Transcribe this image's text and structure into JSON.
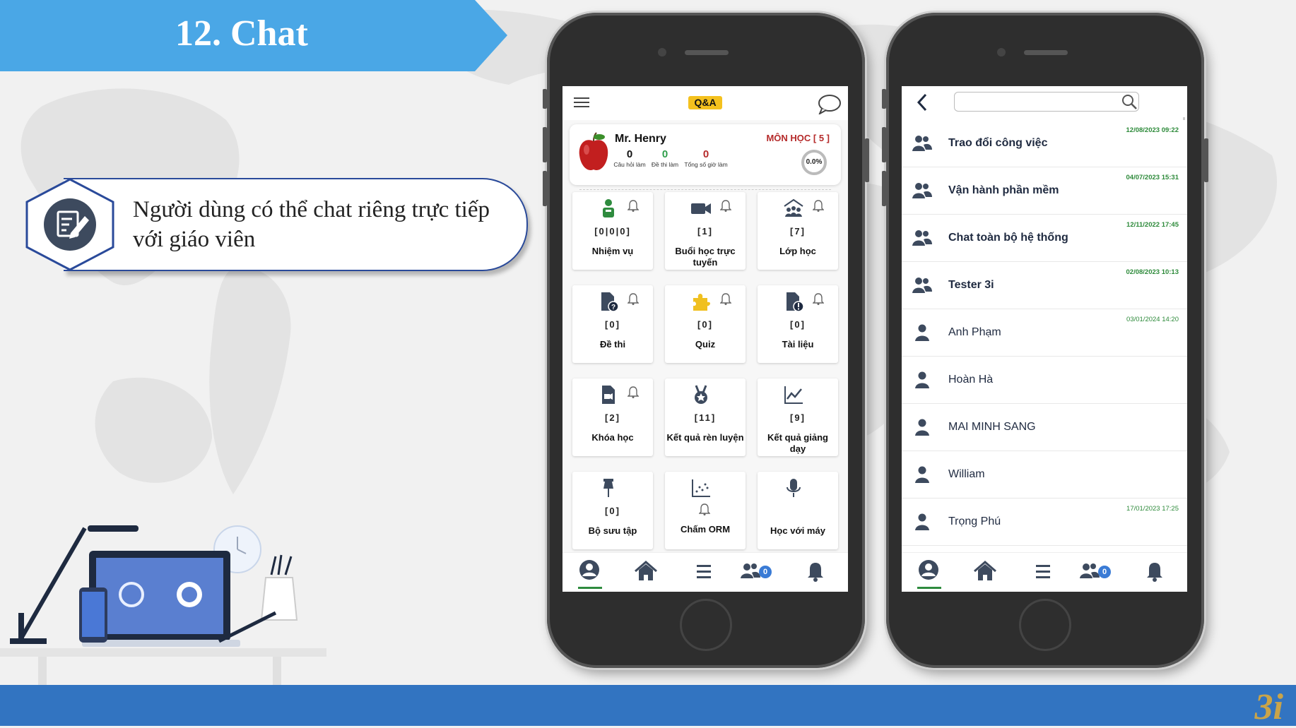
{
  "slide": {
    "title": "12. Chat",
    "callout_text": "Người dùng có thể chat riêng trực tiếp với giáo viên",
    "logo_text": "3i",
    "colors": {
      "banner": "#4aa7e6",
      "bottom_bar": "#3274c1",
      "callout_border": "#2a4a9a"
    }
  },
  "left_phone": {
    "header": {
      "logo": "Q&A",
      "icons": [
        "menu-icon",
        "chat-bubble-icon"
      ]
    },
    "profile": {
      "name": "Mr. Henry",
      "subject_label": "MÔN HỌC [ 5 ]",
      "progress": "0.0%",
      "stats": [
        {
          "value": "0",
          "label": "Câu hỏi làm",
          "color": "#111111"
        },
        {
          "value": "0",
          "label": "Đề thi làm",
          "color": "#2e9e4a"
        },
        {
          "value": "0",
          "label": "Tổng số giờ làm",
          "color": "#b52a2a"
        }
      ]
    },
    "tiles": [
      {
        "label": "Nhiệm vụ",
        "count": "[0|0|0]",
        "icon": "task-person-icon"
      },
      {
        "label": "Buổi học trực tuyến",
        "count": "[1]",
        "icon": "video-icon"
      },
      {
        "label": "Lớp học",
        "count": "[7]",
        "icon": "classroom-icon"
      },
      {
        "label": "Đề thi",
        "count": "[0]",
        "icon": "exam-doc-icon"
      },
      {
        "label": "Quiz",
        "count": "[0]",
        "icon": "puzzle-icon"
      },
      {
        "label": "Tài liệu",
        "count": "[0]",
        "icon": "document-alert-icon"
      },
      {
        "label": "Khóa học",
        "count": "[2]",
        "icon": "course-icon"
      },
      {
        "label": "Kết quả rèn luyện",
        "count": "[11]",
        "icon": "medal-icon"
      },
      {
        "label": "Kết quả giảng dạy",
        "count": "[9]",
        "icon": "chart-line-icon"
      },
      {
        "label": "Bộ sưu tập",
        "count": "[0]",
        "icon": "pin-icon"
      },
      {
        "label": "Chấm ORM",
        "count": "",
        "icon": "scatter-icon"
      },
      {
        "label": "Học với máy",
        "count": "",
        "icon": "microphone-icon"
      }
    ],
    "bottom_nav": {
      "badge_count": "0",
      "items": [
        "profile-icon",
        "home-icon",
        "menu-icon",
        "group-icon",
        "bell-icon"
      ]
    }
  },
  "right_phone": {
    "search_placeholder": "",
    "chats": [
      {
        "name": "Trao đổi công việc",
        "time": "12/08/2023 09:22",
        "group": true
      },
      {
        "name": "Vận hành phần mềm",
        "time": "04/07/2023 15:31",
        "group": true
      },
      {
        "name": "Chat toàn bộ hệ thống",
        "time": "12/11/2022 17:45",
        "group": true
      },
      {
        "name": "Tester 3i",
        "time": "02/08/2023 10:13",
        "group": true
      },
      {
        "name": "Anh Phạm",
        "time": "03/01/2024 14:20",
        "group": false
      },
      {
        "name": "Hoàn Hà",
        "time": "",
        "group": false
      },
      {
        "name": "MAI MINH SANG",
        "time": "",
        "group": false
      },
      {
        "name": "William",
        "time": "",
        "group": false
      },
      {
        "name": "Trọng Phú",
        "time": "17/01/2023 17:25",
        "group": false
      }
    ],
    "bottom_nav": {
      "badge_count": "0"
    }
  }
}
